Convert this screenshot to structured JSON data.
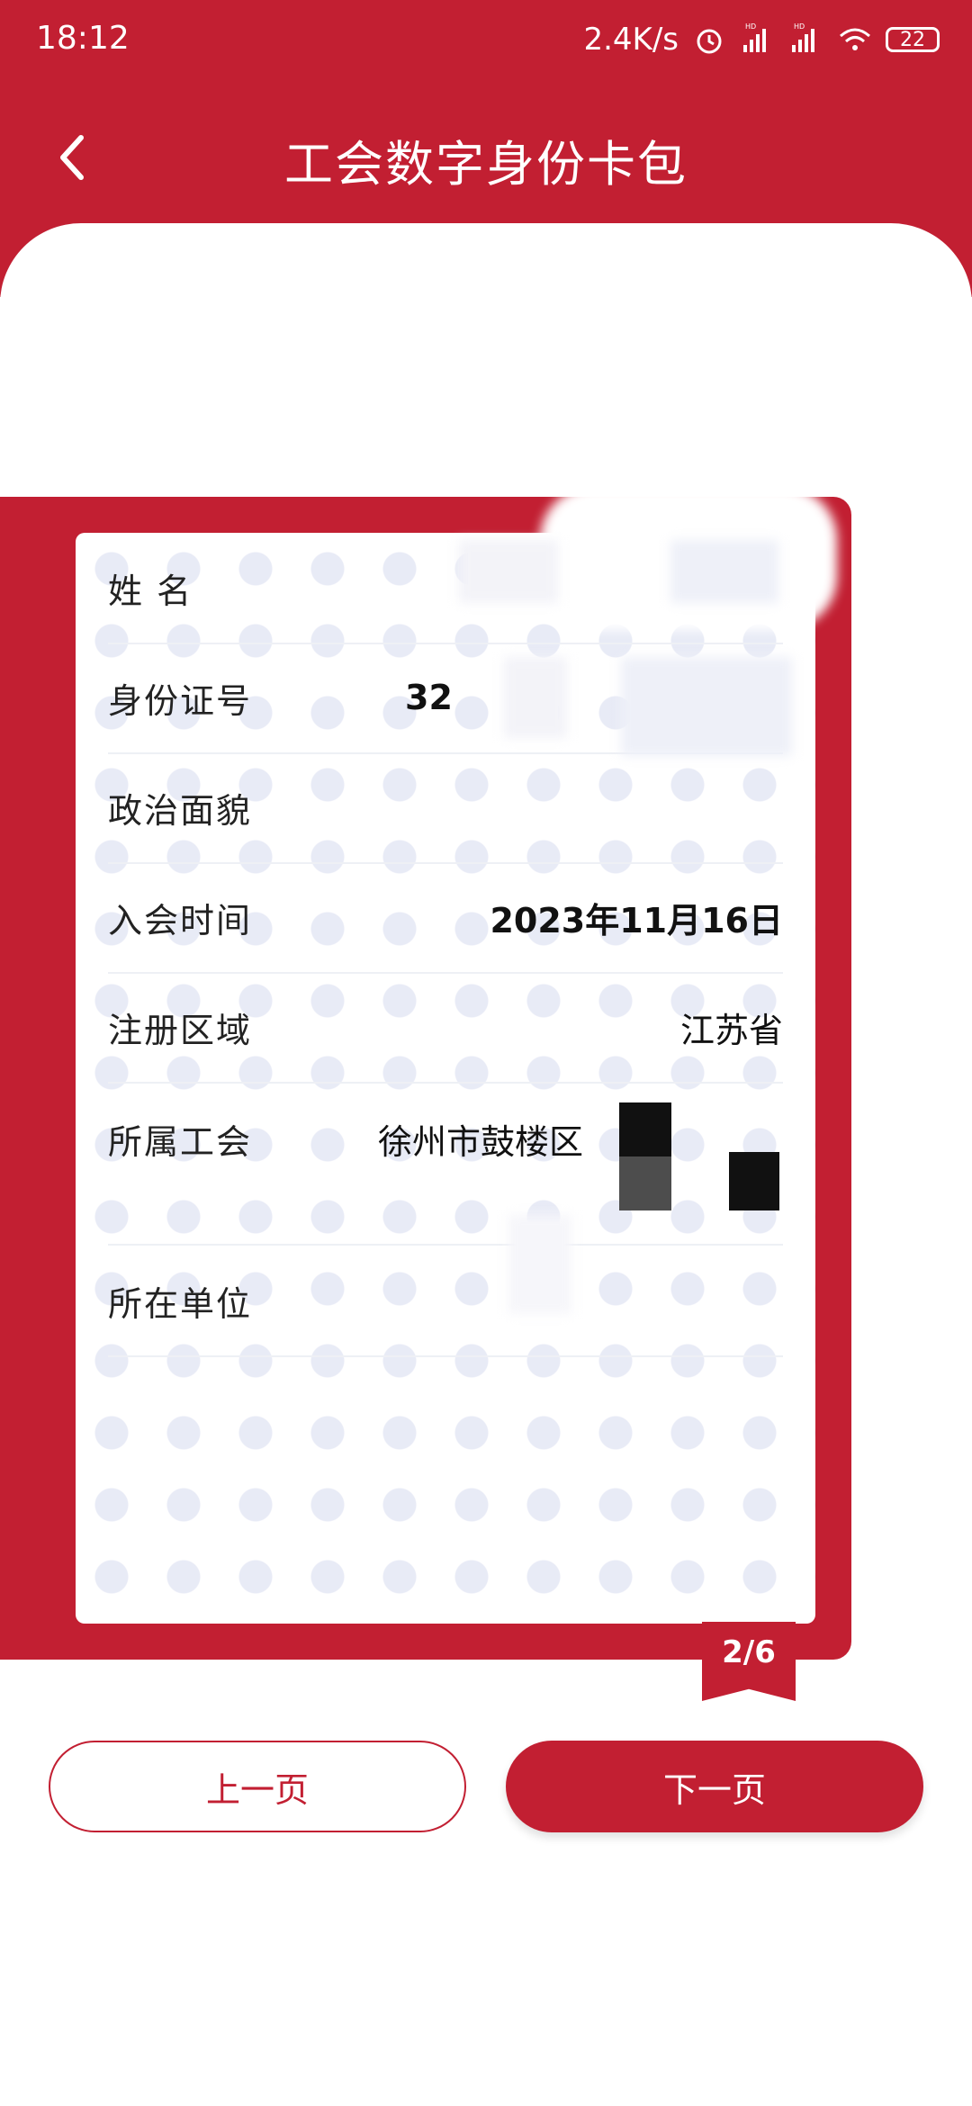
{
  "status_bar": {
    "time": "18:12",
    "net_speed": "2.4K/s",
    "battery": "22",
    "icons": [
      "alarm-icon",
      "hd-signal-icon",
      "hd-signal-icon",
      "wifi-icon",
      "battery-icon"
    ]
  },
  "header": {
    "title": "工会数字身份卡包",
    "back_icon": "chevron-left-icon"
  },
  "card": {
    "rows": [
      {
        "label": "姓 名",
        "value": ""
      },
      {
        "label": "身份证号",
        "value": "32"
      },
      {
        "label": "政治面貌",
        "value": ""
      },
      {
        "label": "入会时间",
        "value": "2023年11月16日"
      },
      {
        "label": "注册区域",
        "value": "江苏省"
      },
      {
        "label": "所属工会",
        "value": "徐州市鼓楼区"
      },
      {
        "label": "所在单位",
        "value": ""
      }
    ],
    "page_indicator": "2/6"
  },
  "buttons": {
    "prev": "上一页",
    "next": "下一页"
  },
  "colors": {
    "brand_red": "#c21f32",
    "background": "#ffffff"
  }
}
